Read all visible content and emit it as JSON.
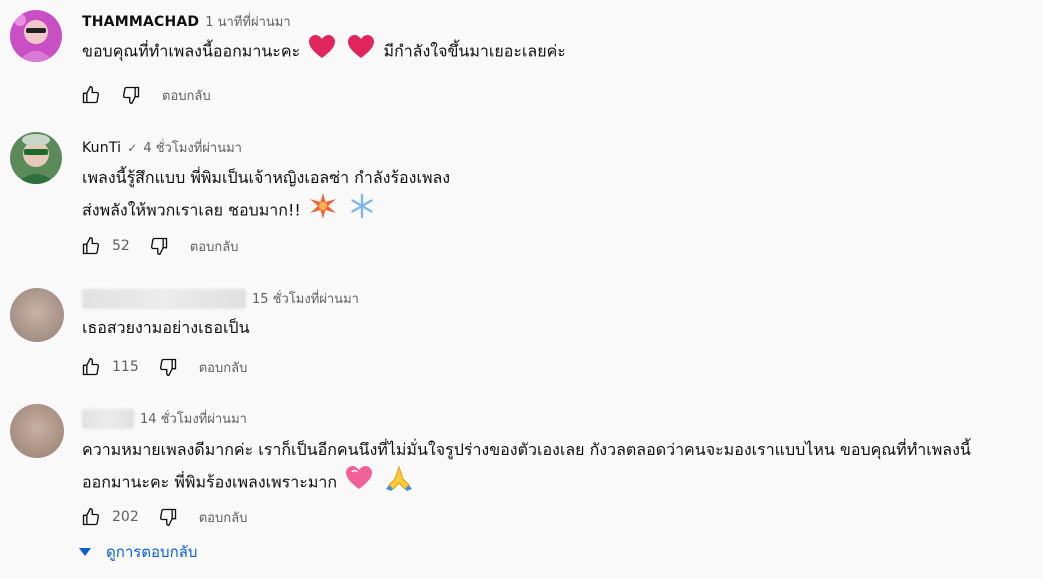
{
  "comments": [
    {
      "author": "THAMMACHAD",
      "time": "1 นาทีที่ผ่านมา",
      "lines": [
        "ขอบคุณที่ทำเพลงนี้ออกมานะคะ",
        "มีกำลังใจขึ้นมาเยอะเลยค่ะ"
      ],
      "likes": "",
      "reply_label": "ตอบกลับ"
    },
    {
      "author": "KunTi",
      "time": "4 ชั่วโมงที่ผ่านมา",
      "lines": [
        "เพลงนี้รู้สึกแบบ พี่พิมเป็นเจ้าหญิงเอลซ่า กำลังร้องเพลง",
        "ส่งพลังให้พวกเราเลย ชอบมาก!!"
      ],
      "likes": "52",
      "reply_label": "ตอบกลับ"
    },
    {
      "author": "",
      "time": "15 ชั่วโมงที่ผ่านมา",
      "lines": [
        "เธอสวยงามอย่างเธอเป็น"
      ],
      "likes": "115",
      "reply_label": "ตอบกลับ"
    },
    {
      "author": "",
      "time": "14 ชั่วโมงที่ผ่านมา",
      "lines": [
        "ความหมายเพลงดีมากค่ะ เราก็เป็นอีกคนนึงที่ไม่มั่นใจรูปร่างของตัวเองเลย กังวลตลอดว่าคนจะมองเราแบบไหน ขอบคุณที่ทำเพลงนี้",
        "ออกมานะคะ พี่พิมร้องเพลงเพราะมาก"
      ],
      "likes": "202",
      "reply_label": "ตอบกลับ"
    }
  ],
  "view_replies_label": "ดูการตอบกลับ",
  "colors": {
    "link": "#065fd4",
    "heart": "#e0245e",
    "secondary": "#606060"
  }
}
